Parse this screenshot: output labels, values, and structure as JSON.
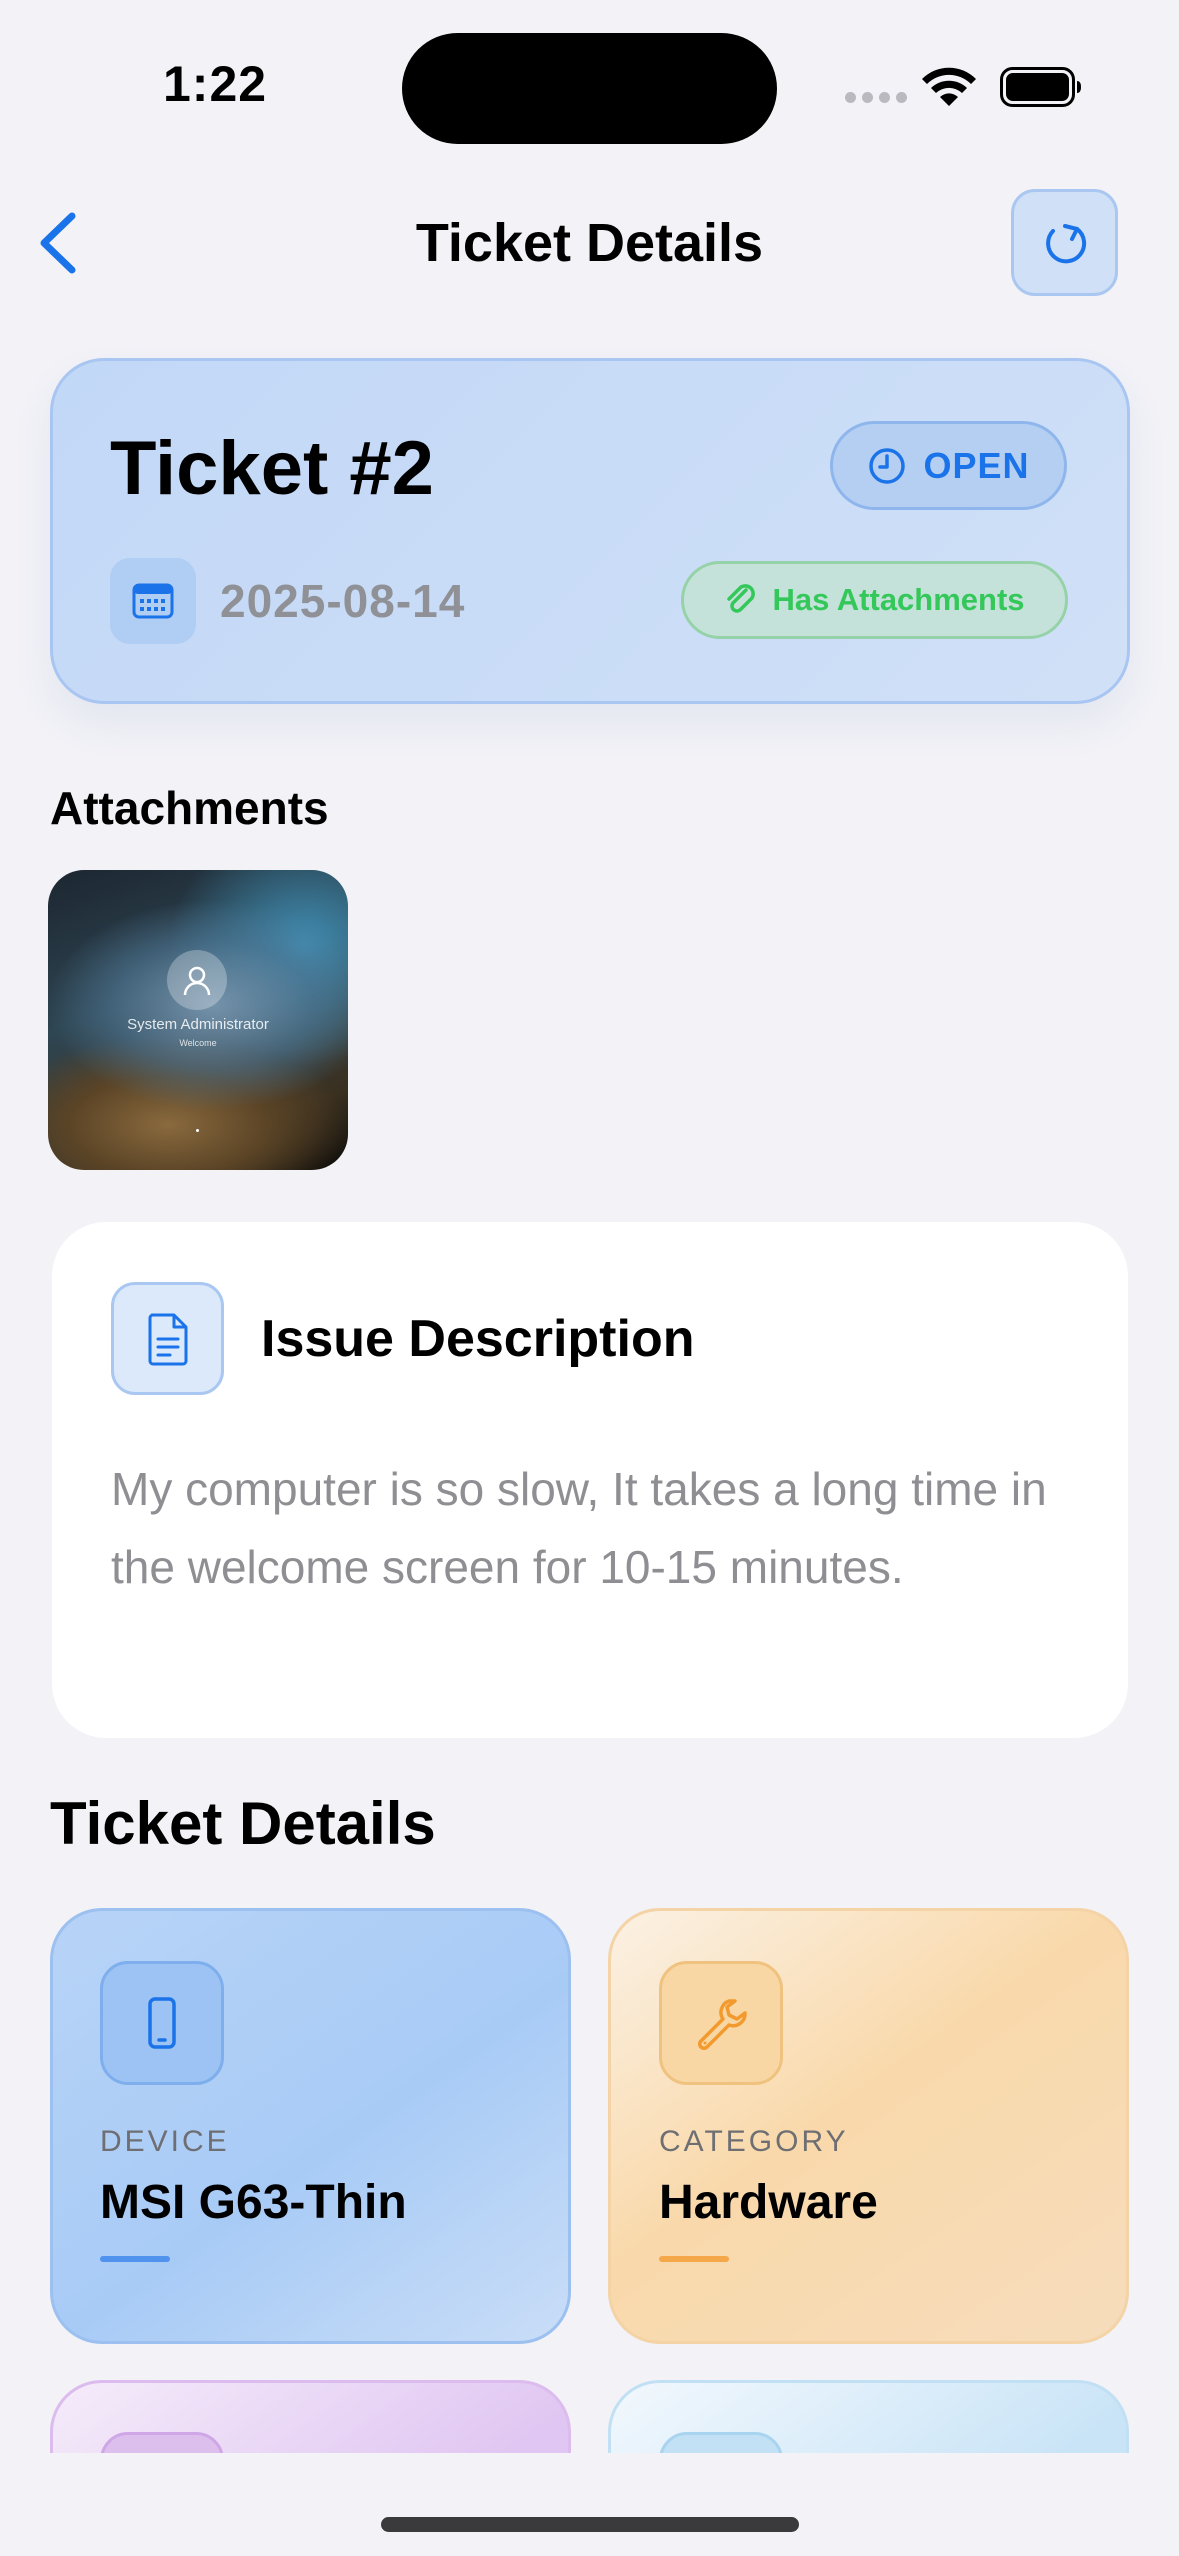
{
  "status_bar": {
    "time": "1:22"
  },
  "nav": {
    "title": "Ticket Details",
    "back_icon": "chevron-left-icon",
    "refresh_icon": "refresh-icon"
  },
  "ticket": {
    "title": "Ticket #2",
    "status": "OPEN",
    "date": "2025-08-14",
    "attachments_badge": "Has Attachments"
  },
  "attachments": {
    "heading": "Attachments",
    "items": [
      {
        "caption": "System Administrator",
        "subcaption": "Welcome"
      }
    ]
  },
  "description": {
    "title": "Issue Description",
    "text": "My computer is so slow, It takes a long time in the welcome screen for 10-15 minutes."
  },
  "details": {
    "heading": "Ticket Details",
    "cards": [
      {
        "label": "DEVICE",
        "value": "MSI G63-Thin",
        "icon": "phone-icon",
        "accent": "#4f93ee"
      },
      {
        "label": "CATEGORY",
        "value": "Hardware",
        "icon": "wrench-icon",
        "accent": "#f5a84a"
      }
    ]
  },
  "colors": {
    "accent_blue": "#1a73e8",
    "success_green": "#34c759",
    "background": "#f2f2f7"
  }
}
